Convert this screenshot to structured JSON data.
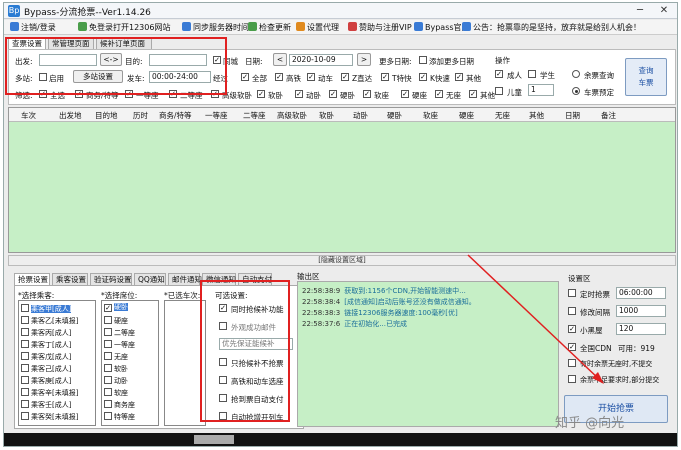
{
  "window": {
    "title": "Bypass-分流抢票--Ver1.14.26",
    "logo": "Bp"
  },
  "menu": [
    {
      "label": "注销/登录",
      "color": "#3a7bd5",
      "icon": "user-icon"
    },
    {
      "label": "免登录打开12306网站",
      "color": "#4a9d4a",
      "icon": "globe-icon"
    },
    {
      "label": "同步服务器时间",
      "color": "#3a7bd5",
      "icon": "clock-icon"
    },
    {
      "label": "检查更新",
      "color": "#4a9d4a",
      "icon": "refresh-icon"
    },
    {
      "label": "设置代理",
      "color": "#e08a1e",
      "icon": "gear-icon"
    },
    {
      "label": "赞助与注册VIP",
      "color": "#d04040",
      "icon": "heart-icon"
    },
    {
      "label": "Bypass官网",
      "color": "#3a7bd5",
      "icon": "home-icon"
    },
    {
      "label": "公告：抢票靠的是坚持，放弃就是给别人机会！",
      "color": "#3a7bd5",
      "icon": "info-icon"
    }
  ],
  "top_tabs": [
    "查票设置",
    "常管理页面",
    "候补订单页面"
  ],
  "query": {
    "from_label": "出发:",
    "swap_label": "<->",
    "to_label": "目的:",
    "multi_label": "多站:",
    "multi_enable": "启用",
    "multi_btn": "多站设置",
    "depart_label": "发车:",
    "depart_value": "00:00-24:00",
    "city_label": "同城",
    "date_label": "日期:",
    "date_value": "2020-10-09",
    "prev": "<",
    "next": ">",
    "more_date_label": "更多日期:",
    "add_more_date": "添加更多日期",
    "filter_label": "筛选:",
    "pass_label": "经过",
    "train_types": [
      "全部",
      "高铁",
      "动车",
      "Z直达",
      "T特快",
      "K快速",
      "其他"
    ],
    "seat_filters": [
      "全选",
      "商务/特等",
      "一等座",
      "二等座",
      "高级软卧",
      "软卧",
      "动卧",
      "硬卧",
      "软座",
      "硬座",
      "无座",
      "其他"
    ],
    "op_label": "操作",
    "adult": "成人",
    "student": "学生",
    "child": "儿童",
    "child_count": "1",
    "remain_query": "余票查询",
    "train_type_reserve": "车票预定",
    "query_btn": "查询\n车票"
  },
  "grid_headers": [
    "车次",
    "出发地",
    "目的地",
    "历时",
    "商务/特等",
    "一等座",
    "二等座",
    "高级软卧",
    "软卧",
    "动卧",
    "硬卧",
    "软座",
    "硬座",
    "无座",
    "其他",
    "日期",
    "备注"
  ],
  "hide_bar": "[隐藏设置区域]",
  "bottom_tabs": [
    "抢票设置",
    "乘客设置",
    "验证码设置",
    "QQ通知",
    "邮件通知",
    "微信通知",
    "自动支付"
  ],
  "passenger": {
    "title": "*选择乘客:",
    "items": [
      "乘客甲[成人]",
      "乘客乙[未填报]",
      "乘客丙[成人]",
      "乘客丁[成人]",
      "乘客戊[成人]",
      "乘客己[成人]",
      "乘客庚[成人]",
      "乘客辛[未填报]",
      "乘客壬[成人]",
      "乘客癸[未填报]"
    ]
  },
  "seat": {
    "title": "*选择席位:",
    "items": [
      "硬卧",
      "硬座",
      "二等座",
      "一等座",
      "无座",
      "软卧",
      "动卧",
      "软座",
      "商务座",
      "特等座"
    ]
  },
  "selected_trains_title": "*已选车次:",
  "options": {
    "title": "可选设置:",
    "items": [
      {
        "label": "同时抢候补功能",
        "checked": true
      },
      {
        "label": "外观成功邮件",
        "checked": false
      },
      {
        "label": "优先保证能候补",
        "checked": false,
        "select": true
      },
      {
        "label": "只抢候补不抢票",
        "checked": false
      },
      {
        "label": "高铁和动车选座",
        "checked": false
      },
      {
        "label": "抢到票自动支付",
        "checked": false
      },
      {
        "label": "自动抢增开列车",
        "checked": false
      }
    ]
  },
  "output": {
    "title": "输出区",
    "lines": [
      {
        "time": "22:58:38:9",
        "msg": "获取到:1156个CDN,开始智能测速中..."
      },
      {
        "time": "22:58:38:4",
        "msg": "[成信通知]启动后账号还没有做成信通知。"
      },
      {
        "time": "22:58:38:3",
        "msg": "链接12306服务器速度:100毫秒[优]"
      },
      {
        "time": "22:58:37:6",
        "msg": "正在初始化...已完成"
      }
    ]
  },
  "settings": {
    "title": "设置区",
    "timed": {
      "label": "定时抢票",
      "value": "06:00:00",
      "checked": false
    },
    "interval": {
      "label": "修改间隔",
      "value": "1000",
      "checked": false
    },
    "black": {
      "label": "小黑屋",
      "value": "120",
      "checked": true
    },
    "cdn": {
      "label": "全国CDN",
      "status": "可用：919",
      "checked": true
    },
    "o1": {
      "label": "有时余票无座时,不提交",
      "checked": false
    },
    "o2": {
      "label": "余票不足要求时,部分提交",
      "checked": false
    }
  },
  "start_btn": "开始抢票",
  "watermark": "知乎 @向光"
}
